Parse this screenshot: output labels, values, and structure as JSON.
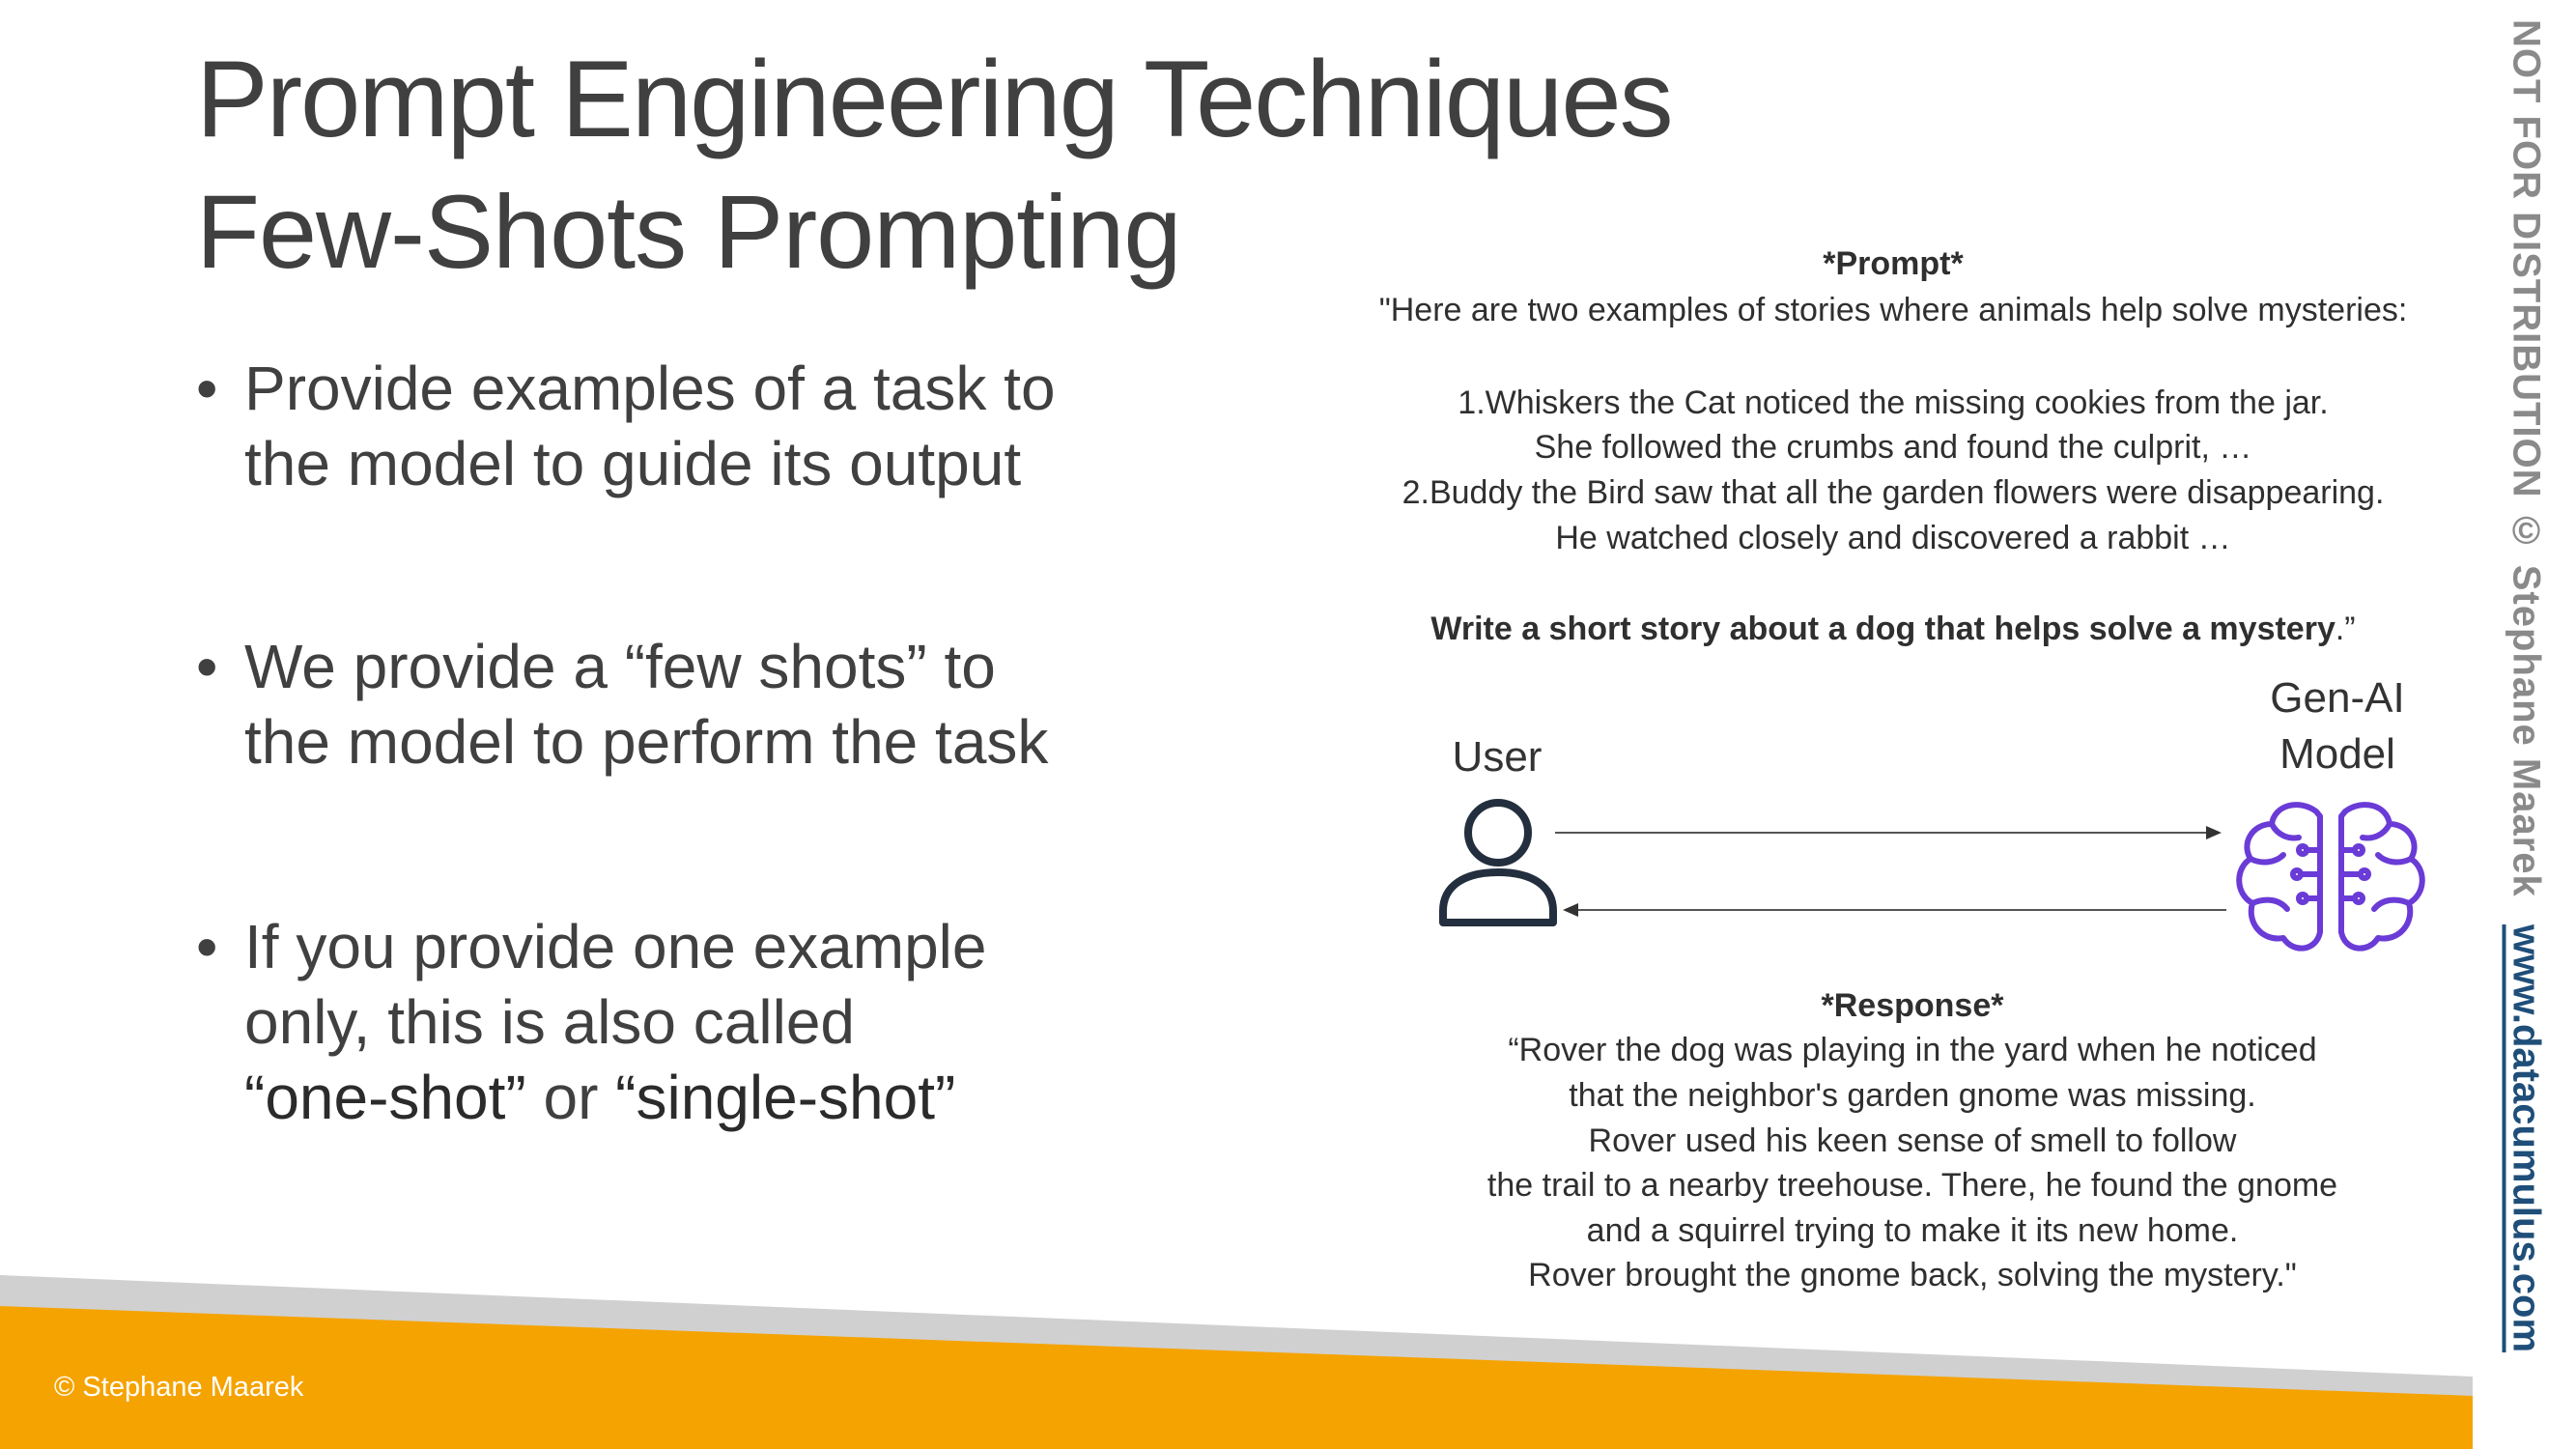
{
  "slide": {
    "title_line1": "Prompt Engineering Techniques",
    "title_line2": "Few-Shots Prompting",
    "bullets": [
      {
        "lines": [
          "Provide examples of a task to",
          "the model to guide its output"
        ]
      },
      {
        "lines": [
          "We provide a “few shots” to",
          "the model to perform the task"
        ]
      },
      {
        "lines": [
          "If you provide one example",
          "only, this is also called"
        ],
        "emph1": "“one-shot”",
        "mid": " or ",
        "emph2": "“single-shot”"
      }
    ],
    "bullet_symbol": "•"
  },
  "prompt": {
    "heading": "*Prompt*",
    "intro": "\"Here are two examples of stories where animals help solve mysteries:",
    "example_lines": [
      "1.Whiskers the Cat noticed the missing cookies from the jar.",
      "She followed the crumbs and found the culprit, …",
      "2.Buddy the Bird saw that all the garden flowers were disappearing.",
      "He watched closely and discovered a rabbit …"
    ],
    "instruction_bold": "Write a short story about a dog that helps solve a mystery",
    "instruction_end": ".”"
  },
  "diagram": {
    "user_label": "User",
    "model_label_line1": "Gen-AI",
    "model_label_line2": "Model",
    "user_icon": "user-icon",
    "model_icon": "brain-circuit-icon",
    "model_color": "#6a3bd6"
  },
  "response": {
    "heading": "*Response*",
    "lines": [
      "“Rover the dog was playing in the yard when he noticed",
      "that the neighbor's garden gnome was missing.",
      "Rover used his keen sense of smell to follow",
      "the trail to a nearby treehouse. There, he found the gnome",
      "and a squirrel trying to make it its new home.",
      "Rover brought the gnome back, solving the mystery.\""
    ]
  },
  "footer": {
    "copyright": "© Stephane Maarek",
    "side_notice": "NOT FOR DISTRIBUTION © Stephane Maarek",
    "side_link": "www.datacumulus.com",
    "band_orange": "#f5a300",
    "band_gray": "#d0d0d0"
  }
}
